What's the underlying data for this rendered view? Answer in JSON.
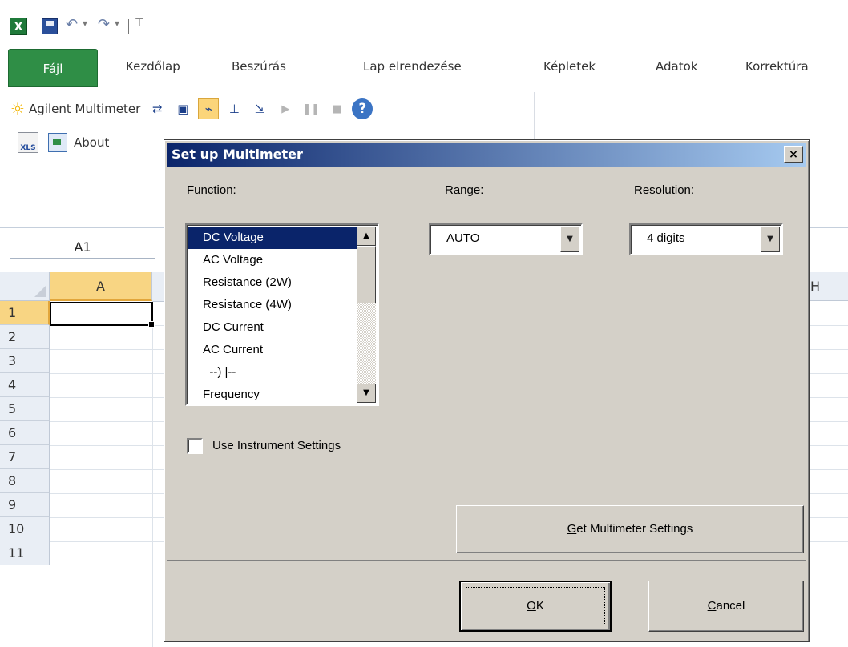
{
  "qat": {
    "excel_icon": "X",
    "undo_glyph": "↶",
    "redo_glyph": "↷",
    "dropdown": "▾",
    "customize": "⊤"
  },
  "ribbon": {
    "tabs": [
      "Fájl",
      "Kezdőlap",
      "Beszúrás",
      "Lap elrendezése",
      "Képletek",
      "Adatok",
      "Korrektúra"
    ],
    "addin_label": "Agilent Multimeter",
    "about_label": "About",
    "help_glyph": "?",
    "xls_icon_text": "XLS"
  },
  "formula_bar": {
    "name_box": "A1"
  },
  "grid": {
    "columns": [
      "A",
      "H"
    ],
    "rows": [
      "1",
      "2",
      "3",
      "4",
      "5",
      "6",
      "7",
      "8",
      "9",
      "10",
      "11"
    ]
  },
  "dialog": {
    "title": "Set up Multimeter",
    "close_glyph": "×",
    "function_label": "Function:",
    "range_label": "Range:",
    "resolution_label": "Resolution:",
    "functions": [
      "DC Voltage",
      "AC Voltage",
      "Resistance (2W)",
      "Resistance (4W)",
      "DC Current",
      "AC Current",
      "  --) |--",
      "Frequency"
    ],
    "selected_function": "DC Voltage",
    "range_value": "AUTO",
    "resolution_value": "4 digits",
    "use_instrument_settings": "Use Instrument Settings",
    "use_instrument_checked": false,
    "get_settings_button": {
      "mnemonic": "G",
      "rest": "et Multimeter Settings"
    },
    "ok_button": {
      "mnemonic": "O",
      "rest": "K"
    },
    "cancel_button": {
      "mnemonic": "C",
      "rest": "ancel"
    },
    "scroll_up": "▲",
    "scroll_down": "▼",
    "dropdown_arrow": "▼"
  },
  "colors": {
    "excel_green": "#2f8e46",
    "title_bar": "#0a246a",
    "selection": "#f8d583"
  }
}
